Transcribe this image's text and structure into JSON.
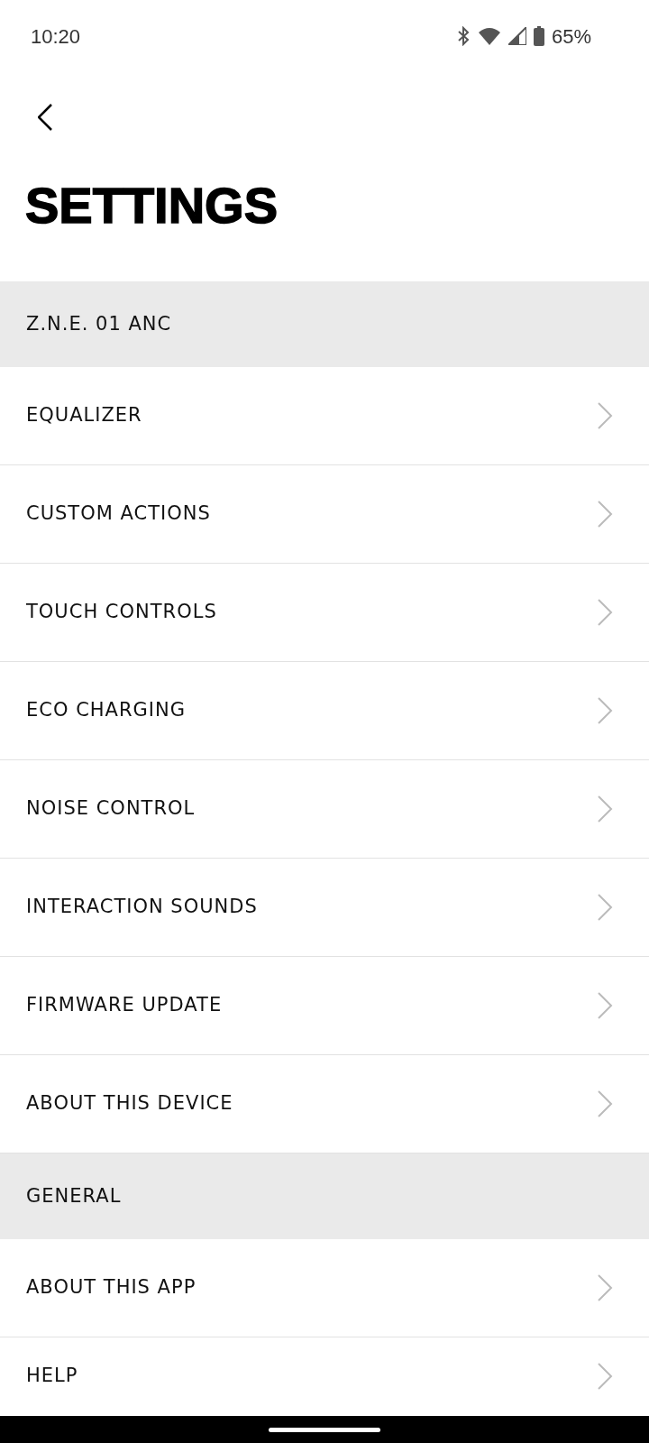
{
  "status_bar": {
    "time": "10:20",
    "battery": "65%"
  },
  "title": "SETTINGS",
  "sections": [
    {
      "header": "Z.N.E. 01 ANC",
      "items": [
        {
          "label": "EQUALIZER"
        },
        {
          "label": "CUSTOM ACTIONS"
        },
        {
          "label": "TOUCH CONTROLS"
        },
        {
          "label": "ECO CHARGING"
        },
        {
          "label": "NOISE CONTROL"
        },
        {
          "label": "INTERACTION SOUNDS"
        },
        {
          "label": "FIRMWARE UPDATE"
        },
        {
          "label": "ABOUT THIS DEVICE"
        }
      ]
    },
    {
      "header": "GENERAL",
      "items": [
        {
          "label": "ABOUT THIS APP"
        },
        {
          "label": "HELP"
        }
      ]
    }
  ]
}
